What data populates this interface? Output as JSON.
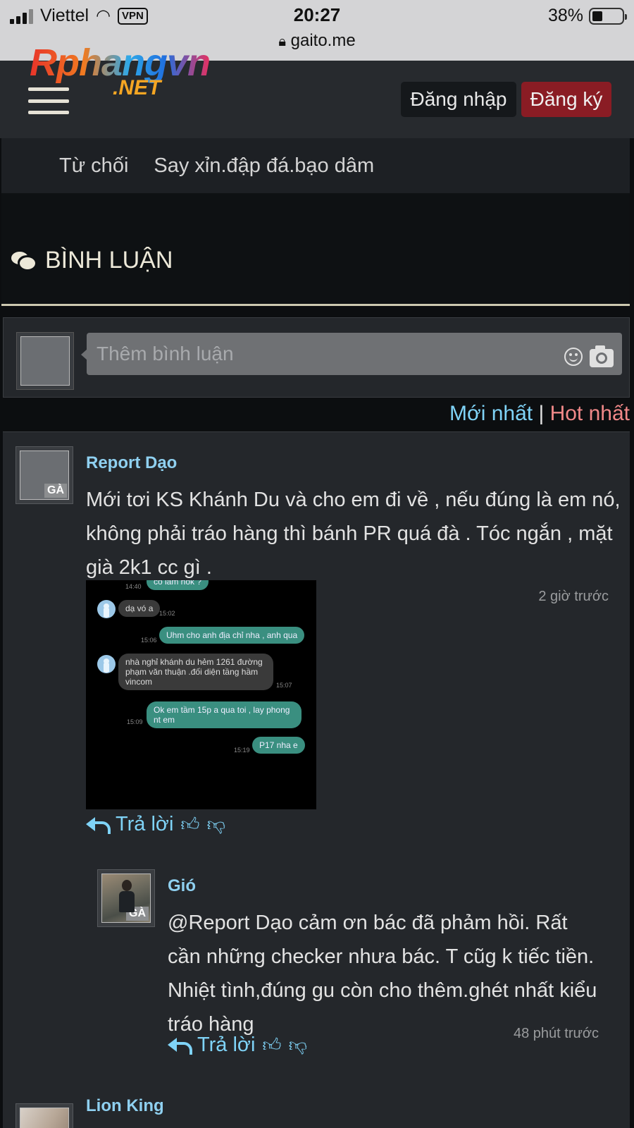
{
  "status_bar": {
    "carrier": "Viettel",
    "vpn": "VPN",
    "time": "20:27",
    "url": "gaito.me",
    "battery": "38%"
  },
  "header": {
    "logo_main": "Rphangvn",
    "logo_sub": ".NET",
    "login_label": "Đăng nhập",
    "register_label": "Đăng ký"
  },
  "tags": {
    "label": "Từ chối",
    "value": "Say xỉn.đập đá.bạo dâm"
  },
  "comments_section": {
    "title": "BÌNH LUẬN",
    "input_placeholder": "Thêm bình luận",
    "sort_newest": "Mới nhất",
    "sort_separator": "|",
    "sort_hot": "Hot nhất"
  },
  "comments": [
    {
      "author": "Report Dạo",
      "rank": "GÀ",
      "text": "Mới tơi KS Khánh Du và cho em đi về , nếu đúng là em nó, không phải tráo hàng thì bánh PR quá đà . Tóc ngắn , mặt già 2k1 cc gì .",
      "time": "2 giờ trước",
      "reply_label": "Trả lời",
      "attachment": {
        "messages": [
          {
            "side": "right",
            "text": "co lam hok ?",
            "time": "14:40"
          },
          {
            "side": "left",
            "text": "dạ vó a",
            "time": "15:02"
          },
          {
            "side": "right",
            "text": "Uhm cho anh địa chỉ nha , anh qua",
            "time": "15:06"
          },
          {
            "side": "left",
            "text": "nhà nghỉ khánh du hẻm 1261 đường phạm văn thuận .đối diện tầng hầm vincom",
            "time": "15:07"
          },
          {
            "side": "right",
            "text": "Ok em tầm 15p a qua toi , lay phong nt em",
            "time": "15:09"
          },
          {
            "side": "right",
            "text": "P17 nha e",
            "time": "15:19"
          }
        ]
      }
    },
    {
      "author": "Gió",
      "rank": "GÀ",
      "text": "@Report Dạo cảm ơn bác đã phảm hồi. Rất cần những checker nhưa bác. T cũg k tiếc tiền. Nhiệt tình,đúng gu còn cho thêm.ghét nhất kiểu tráo hàng",
      "time": "48 phút trước",
      "reply_label": "Trả lời"
    },
    {
      "author": "Lion King"
    }
  ],
  "colors": {
    "accent": "#7fd3f7",
    "hot": "#f08888",
    "register": "#8a1c24",
    "background": "#24272b"
  }
}
